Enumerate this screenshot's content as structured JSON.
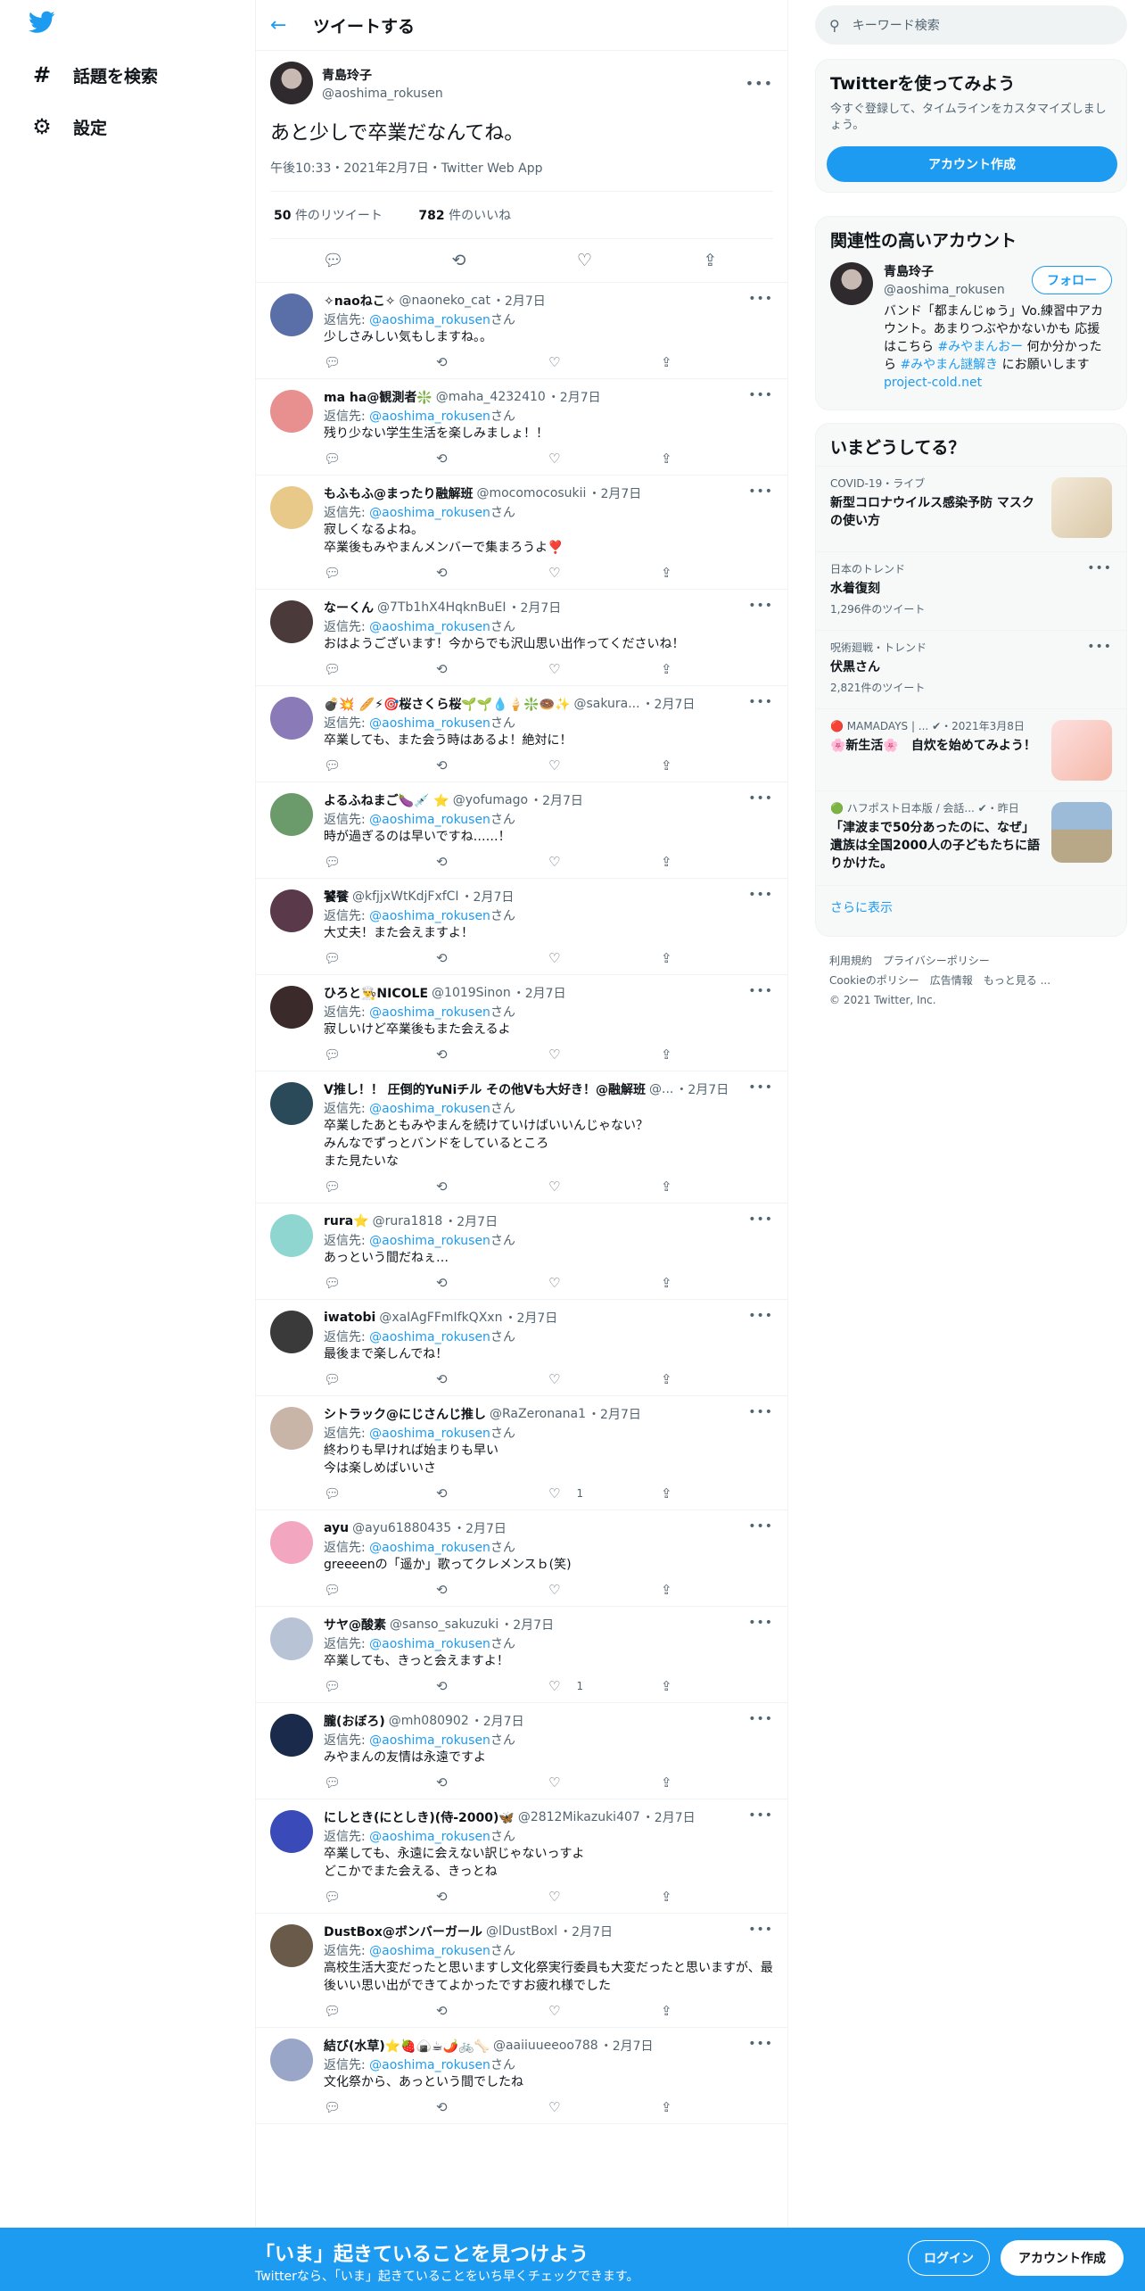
{
  "nav": {
    "explore": "話題を検索",
    "settings": "設定"
  },
  "header": {
    "title": "ツイートする"
  },
  "main_tweet": {
    "name": "青島玲子",
    "handle": "@aoshima_rokusen",
    "text": "あと少しで卒業だなんてね。",
    "meta": "午後10:33・2021年2月7日・Twitter Web App",
    "retweets_count": "50",
    "retweets_label": "件のリツイート",
    "likes_count": "782",
    "likes_label": "件のいいね"
  },
  "reply_prefix": "返信先: ",
  "reply_suffix": "さん",
  "replies": [
    {
      "name": "✧naoねこ✧",
      "handle": "@naoneko_cat",
      "time": "・2月7日",
      "mention": "@aoshima_rokusen",
      "text": "少しさみしい気もしますね。。",
      "likes": "",
      "avatar_color": "#5a6fa8"
    },
    {
      "name": "ma ha@観測者❇️",
      "handle": "@maha_4232410",
      "time": "・2月7日",
      "mention": "@aoshima_rokusen",
      "text": "残り少ない学生生活を楽しみましょ！！",
      "likes": "",
      "avatar_color": "#e88f8f"
    },
    {
      "name": "もふもふ@まったり融解班",
      "handle": "@mocomocosukii",
      "time": "・2月7日",
      "mention": "@aoshima_rokusen",
      "text": "寂しくなるよね。\n卒業後もみやまんメンバーで集まろうよ❣️",
      "likes": "",
      "avatar_color": "#e8c98a"
    },
    {
      "name": "なーくん",
      "handle": "@7Tb1hX4HqknBuEI",
      "time": "・2月7日",
      "mention": "@aoshima_rokusen",
      "text": "おはようございます！今からでも沢山思い出作ってくださいね！",
      "likes": "",
      "avatar_color": "#4a3b3a"
    },
    {
      "name": "💣💥 🥖⚡🎯桜さくら桜🌱🌱💧🍦❇️🍩✨",
      "handle": "@sakura...",
      "time": "・2月7日",
      "mention": "@aoshima_rokusen",
      "text": "卒業しても、また会う時はあるよ！絶対に！",
      "likes": "",
      "avatar_color": "#8a7bb8"
    },
    {
      "name": "よるふねまご🍆💉 ⭐",
      "handle": "@yofumago",
      "time": "・2月7日",
      "mention": "@aoshima_rokusen",
      "text": "時が過ぎるのは早いですね……！",
      "likes": "",
      "avatar_color": "#6b9a6b"
    },
    {
      "name": "饕餮",
      "handle": "@kfjjxWtKdjFxfCI",
      "time": "・2月7日",
      "mention": "@aoshima_rokusen",
      "text": "大丈夫！また会えますよ！",
      "likes": "",
      "avatar_color": "#5a3a4a"
    },
    {
      "name": "ひろと👨‍🍳NICOLE",
      "handle": "@1019Sinon",
      "time": "・2月7日",
      "mention": "@aoshima_rokusen",
      "text": "寂しいけど卒業後もまた会えるよ",
      "likes": "",
      "avatar_color": "#3a2a2a"
    },
    {
      "name": "V推し！！ 圧倒的YuNiチル その他Vも大好き！@融解班",
      "handle": "@...",
      "time": "・2月7日",
      "mention": "@aoshima_rokusen",
      "text": "卒業したあともみやまんを続けていけばいいんじゃない？\nみんなでずっとバンドをしているところ\nまた見たいな",
      "likes": "",
      "avatar_color": "#2a4a5a"
    },
    {
      "name": "rura⭐",
      "handle": "@rura1818",
      "time": "・2月7日",
      "mention": "@aoshima_rokusen",
      "text": "あっという間だねぇ…",
      "likes": "",
      "avatar_color": "#8fd6d1"
    },
    {
      "name": "iwatobi",
      "handle": "@xaIAgFFmIfkQXxn",
      "time": "・2月7日",
      "mention": "@aoshima_rokusen",
      "text": "最後まで楽しんでね！",
      "likes": "",
      "avatar_color": "#3a3a3a"
    },
    {
      "name": "シトラック@にじさんじ推し",
      "handle": "@RaZeronana1",
      "time": "・2月7日",
      "mention": "@aoshima_rokusen",
      "text": "終わりも早ければ始まりも早い\n今は楽しめばいいさ",
      "likes": "1",
      "avatar_color": "#c9b5a8"
    },
    {
      "name": "ayu",
      "handle": "@ayu61880435",
      "time": "・2月7日",
      "mention": "@aoshima_rokusen",
      "text": "greeeenの「遥か」歌ってクレメンスｂ(笑)",
      "likes": "",
      "avatar_color": "#f2a6c0"
    },
    {
      "name": "サヤ@酸素",
      "handle": "@sanso_sakuzuki",
      "time": "・2月7日",
      "mention": "@aoshima_rokusen",
      "text": "卒業しても、きっと会えますよ！",
      "likes": "1",
      "avatar_color": "#b8c4d6"
    },
    {
      "name": "朧(おぼろ)",
      "handle": "@mh080902",
      "time": "・2月7日",
      "mention": "@aoshima_rokusen",
      "text": "みやまんの友情は永遠ですよ",
      "likes": "",
      "avatar_color": "#1a2a4a"
    },
    {
      "name": "にしとき(にとしき)(侍-2000)🦋",
      "handle": "@2812Mikazuki407",
      "time": "・2月7日",
      "mention": "@aoshima_rokusen",
      "text": "卒業しても、永遠に会えない訳じゃないっすよ\nどこかでまた会える、きっとね",
      "likes": "",
      "avatar_color": "#3a4ab8"
    },
    {
      "name": "DustBox@ボンバーガール",
      "handle": "@lDustBoxl",
      "time": "・2月7日",
      "mention": "@aoshima_rokusen",
      "text": "高校生活大変だったと思いますし文化祭実行委員も大変だったと思いますが、最後いい思い出ができてよかったですお疲れ様でした",
      "likes": "",
      "avatar_color": "#6a5a4a"
    },
    {
      "name": "結び(水草)⭐🍓🍙☕🌶️🚲🦴",
      "handle": "@aaiiuueeoo788",
      "time": "・2月7日",
      "mention": "@aoshima_rokusen",
      "text": "文化祭から、あっという間でしたね",
      "likes": "",
      "avatar_color": "#9aa6c8"
    }
  ],
  "search": {
    "placeholder": "キーワード検索"
  },
  "signup_card": {
    "title": "Twitterを使ってみよう",
    "desc": "今すぐ登録して、タイムラインをカスタマイズしましょう。",
    "button": "アカウント作成"
  },
  "related": {
    "title": "関連性の高いアカウント",
    "name": "青島玲子",
    "handle": "@aoshima_rokusen",
    "follow": "フォロー",
    "bio_1": "バンド「都まんじゅう」Vo.練習中アカウント。あまりつぶやかないかも 応援はこちら ",
    "bio_tag1": "#みやまんおー",
    "bio_2": " 何か分かったら ",
    "bio_tag2": "#みやまん謎解き",
    "bio_3": " にお願いします ",
    "bio_link": "project-cold.net"
  },
  "trends": {
    "title": "いまどうしてる？",
    "items": [
      {
        "meta": "COVID-19・ライブ",
        "title": "新型コロナウイルス感染予防 マスクの使い方",
        "count": ""
      },
      {
        "meta": "日本のトレンド",
        "title": "水着復刻",
        "count": "1,296件のツイート"
      },
      {
        "meta": "呪術廻戦・トレンド",
        "title": "伏黒さん",
        "count": "2,821件のツイート"
      },
      {
        "meta": "🔴 MAMADAYS | ... ✔・2021年3月8日",
        "title": "🌸新生活🌸　自炊を始めてみよう！",
        "count": ""
      },
      {
        "meta": "🟢 ハフポスト日本版 / 会話... ✔・昨日",
        "title": "「津波まで50分あったのに、なぜ」遺族は全国2000人の子どもたちに語りかけた。",
        "count": ""
      }
    ],
    "show_more": "さらに表示"
  },
  "footer": {
    "terms": "利用規約",
    "privacy": "プライバシーポリシー",
    "cookie": "Cookieのポリシー",
    "ads": "広告情報",
    "more": "もっと見る ...",
    "copyright": "© 2021 Twitter, Inc."
  },
  "bottom_bar": {
    "title": "「いま」起きていることを見つけよう",
    "subtitle": "Twitterなら、「いま」起きていることをいち早くチェックできます。",
    "login": "ログイン",
    "signup": "アカウント作成"
  },
  "colors": {
    "accent": "#1d9bf0",
    "text": "#0f1419",
    "muted": "#536471",
    "border": "#eff3f4"
  }
}
